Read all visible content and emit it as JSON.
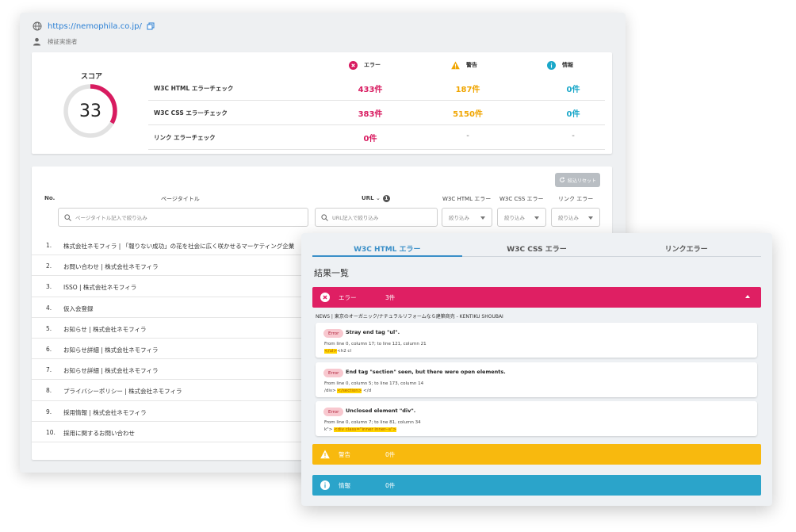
{
  "site": {
    "url": "https://nemophila.co.jp/",
    "user": "検証実施者"
  },
  "score": {
    "title": "スコア",
    "value": "33",
    "percent": 33,
    "columns": {
      "error": "エラー",
      "warning": "警告",
      "info": "情報"
    },
    "rows": [
      {
        "label": "W3C HTML エラーチェック",
        "error": "433件",
        "warning": "187件",
        "info": "0件"
      },
      {
        "label": "W3C CSS エラーチェック",
        "error": "383件",
        "warning": "5150件",
        "info": "0件"
      },
      {
        "label": "リンク エラーチェック",
        "error": "0件",
        "warning": "-",
        "info": "-"
      }
    ],
    "colors": {
      "error": "#d81b60",
      "warning": "#f0a500",
      "info": "#1aa7c9",
      "gauge_track": "#e2e2e2"
    }
  },
  "list": {
    "reset_label": "絞込リセット",
    "headers": {
      "no": "No.",
      "title": "ページタイトル",
      "url": "URL",
      "url_badge": "1",
      "html": "W3C HTML エラー",
      "css": "W3C CSS エラー",
      "link": "リンク エラー"
    },
    "filters": {
      "title_placeholder": "ページタイトル記入で絞り込み",
      "url_placeholder": "URL記入で絞り込み",
      "select": "絞り込み"
    },
    "rows": [
      {
        "no": "1.",
        "title": "株式会社ネモフィラ | 「報りない成功」の花を社会に広く咲かせるマーケティング企業"
      },
      {
        "no": "2.",
        "title": "お問い合わせ | 株式会社ネモフィラ"
      },
      {
        "no": "3.",
        "title": "ISSO | 株式会社ネモフィラ"
      },
      {
        "no": "4.",
        "title": "仮入会登録"
      },
      {
        "no": "5.",
        "title": "お知らせ | 株式会社ネモフィラ"
      },
      {
        "no": "6.",
        "title": "お知らせ詳細 | 株式会社ネモフィラ"
      },
      {
        "no": "7.",
        "title": "お知らせ詳細 | 株式会社ネモフィラ"
      },
      {
        "no": "8.",
        "title": "プライバシーポリシー | 株式会社ネモフィラ"
      },
      {
        "no": "9.",
        "title": "採用情報 | 株式会社ネモフィラ"
      },
      {
        "no": "10.",
        "title": "採用に関するお問い合わせ"
      }
    ]
  },
  "detail": {
    "tabs": [
      "W3C HTML エラー",
      "W3C CSS エラー",
      "リンクエラー"
    ],
    "results_title": "結果一覧",
    "error_bar": {
      "label": "エラー",
      "count": "3件"
    },
    "warning_bar": {
      "label": "警告",
      "count": "0件"
    },
    "info_bar": {
      "label": "情報",
      "count": "0件"
    },
    "page_name": "NEWS | 東京のオーガニック/ナチュラルリフォームなら建築商売 - KENTIKU SHOUBAI",
    "errors": [
      {
        "tag": "Error",
        "message": "Stray end tag \"ul\".",
        "location": "From line 0, column 17; to line 121, column 21",
        "code_before": "",
        "code_hl": "</ul>",
        "code_after": "<h2 cl"
      },
      {
        "tag": "Error",
        "message": "End tag \"section\" seen, but there were open elements.",
        "location": "From line 0, column 5; to line 173, column 14",
        "code_before": "/div> ",
        "code_hl": "</section>",
        "code_after": " </d"
      },
      {
        "tag": "Error",
        "message": "Unclosed element \"div\".",
        "location": "From line 0, column 7; to line 81, column 34",
        "code_before": "k\"> ",
        "code_hl": "<div class=\"inner inner--s\">",
        "code_after": ""
      }
    ],
    "colors": {
      "error": "#df1f63",
      "warning": "#f8b90e",
      "info": "#2ba4ca",
      "tab_active": "#3a8fc8"
    }
  }
}
